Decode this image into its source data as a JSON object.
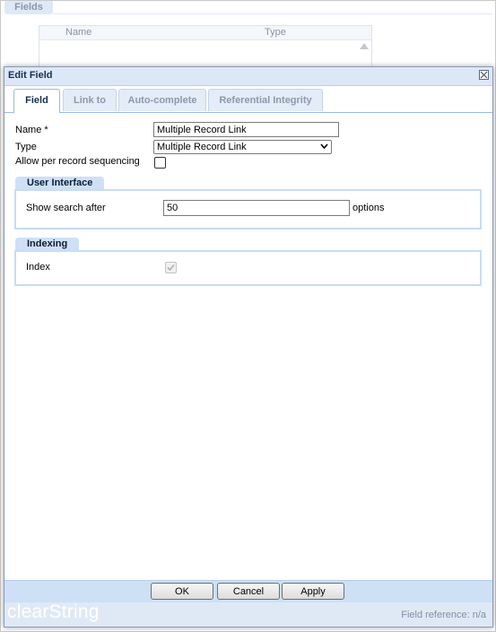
{
  "background": {
    "tab_label": "Fields",
    "grid_columns": [
      "Name",
      "Type"
    ]
  },
  "dialog": {
    "title": "Edit Field",
    "tabs": [
      {
        "label": "Field",
        "active": true
      },
      {
        "label": "Link to",
        "active": false
      },
      {
        "label": "Auto-complete",
        "active": false
      },
      {
        "label": "Referential Integrity",
        "active": false
      }
    ],
    "form": {
      "name_label": "Name *",
      "name_value": "Multiple Record Link",
      "type_label": "Type",
      "type_value": "Multiple Record Link",
      "sequencing_label": "Allow per record sequencing",
      "sequencing_checked": false
    },
    "user_interface": {
      "legend": "User Interface",
      "search_label": "Show search after",
      "search_value": "50",
      "search_suffix": "options"
    },
    "indexing": {
      "legend": "Indexing",
      "index_label": "Index",
      "index_checked": true,
      "index_disabled": true
    },
    "buttons": {
      "ok": "OK",
      "cancel": "Cancel",
      "apply": "Apply"
    },
    "status": {
      "brand": "clearString",
      "field_reference": "Field reference: n/a"
    }
  },
  "colors": {
    "header_bg": "#dce8f8",
    "footer_bg": "#cde0f6",
    "legend_bg": "#cfe0f6",
    "fieldset_border": "#c8dcf4"
  }
}
